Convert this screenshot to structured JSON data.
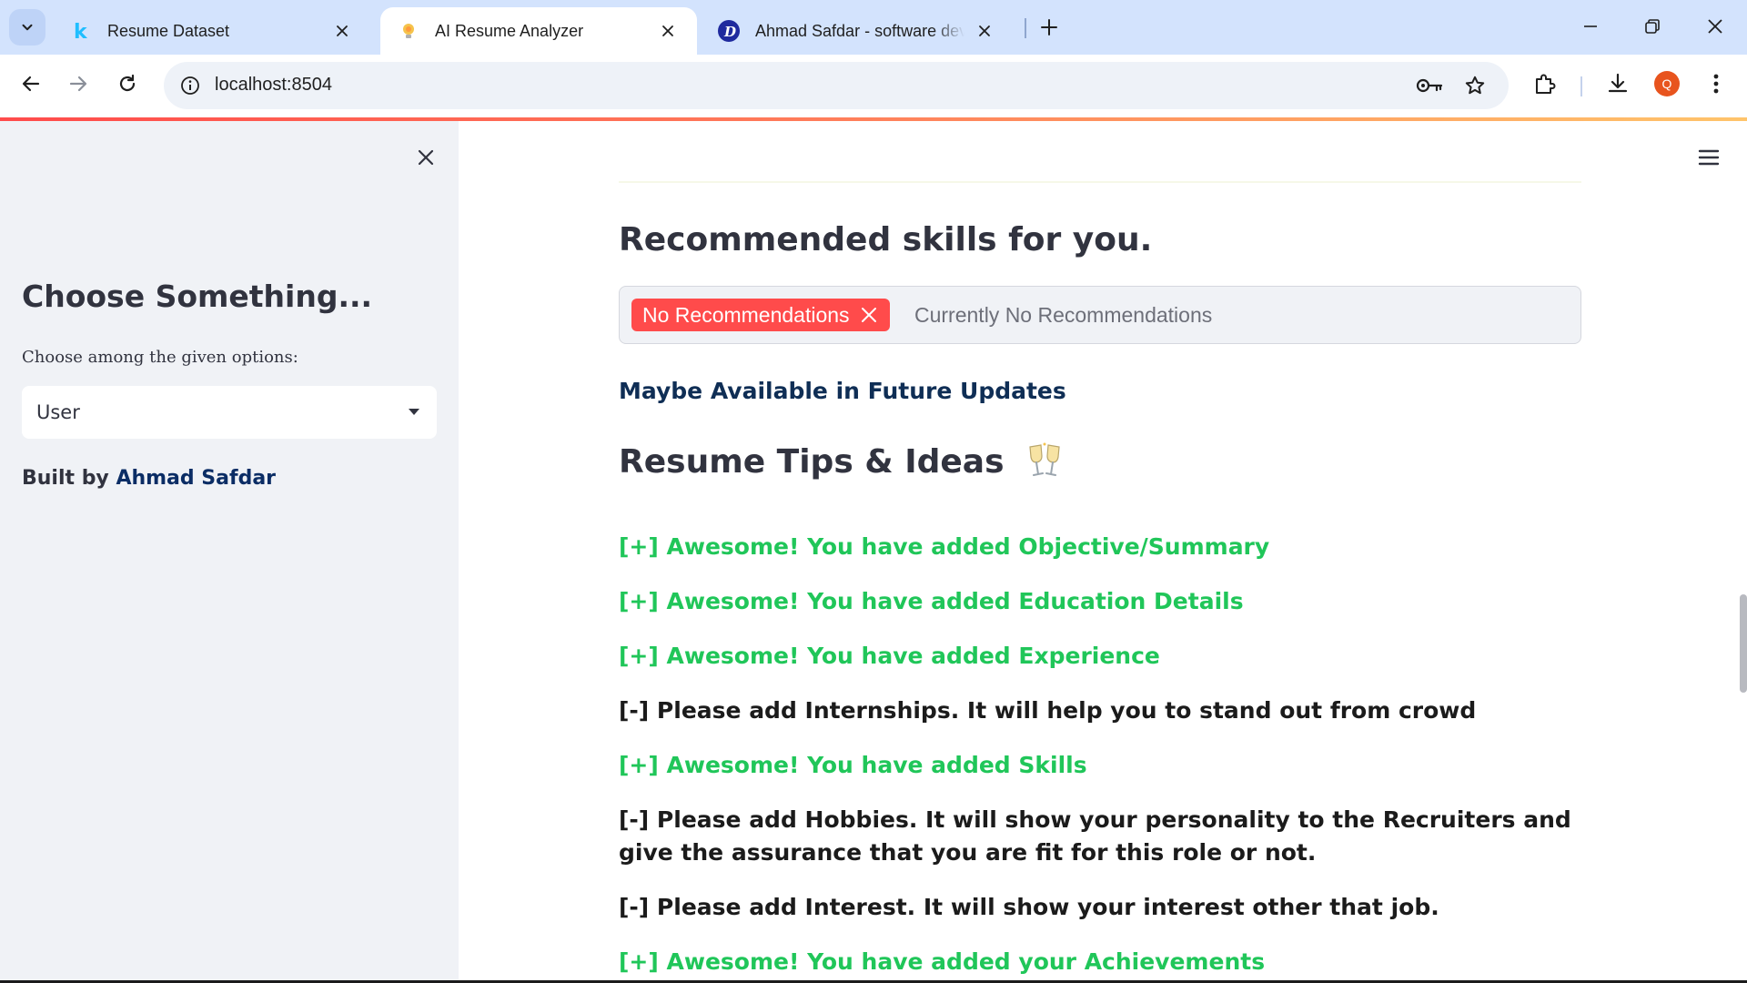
{
  "browser": {
    "tabs": [
      {
        "title": "Resume Dataset",
        "favicon": "kaggle-k-icon"
      },
      {
        "title": "AI Resume Analyzer",
        "favicon": "streamlit-icon",
        "active": true
      },
      {
        "title": "Ahmad Safdar - software develo",
        "favicon": "d-profile-icon"
      }
    ],
    "url": "localhost:8504",
    "profile_initial": "Q",
    "colors": {
      "tabbar": "#d3e3fd",
      "omnibox": "#eef2f8",
      "profile": "#e8541e"
    }
  },
  "sidebar": {
    "title": "Choose Something...",
    "select_label": "Choose among the given options:",
    "select_value": "User",
    "built_by_prefix": "Built by ",
    "built_by_name": "Ahmad Safdar"
  },
  "main": {
    "recommended_heading": "Recommended skills for you.",
    "chip_label": "No Recommendations",
    "placeholder": "Currently No Recommendations",
    "future_updates": "Maybe Available in Future Updates",
    "tips_heading": "Resume Tips & Ideas",
    "tips_emoji": "clinking-glasses-icon",
    "tips": [
      {
        "text": "[+] Awesome! You have added Objective/Summary",
        "status": "good"
      },
      {
        "text": "[+] Awesome! You have added Education Details",
        "status": "good"
      },
      {
        "text": "[+] Awesome! You have added Experience",
        "status": "good"
      },
      {
        "text": "[-] Please add Internships. It will help you to stand out from crowd",
        "status": "bad"
      },
      {
        "text": "[+] Awesome! You have added Skills",
        "status": "good"
      },
      {
        "text": "[-] Please add Hobbies. It will show your personality to the Recruiters and give the assurance that you are fit for this role or not.",
        "status": "bad"
      },
      {
        "text": "[-] Please add Interest. It will show your interest other that job.",
        "status": "bad"
      },
      {
        "text": "[+] Awesome! You have added your Achievements",
        "status": "good"
      }
    ],
    "colors": {
      "good": "#20c659",
      "bad": "#1b1b1b",
      "chip": "#ff4b4b",
      "accent_dark": "#0f2e55"
    }
  }
}
